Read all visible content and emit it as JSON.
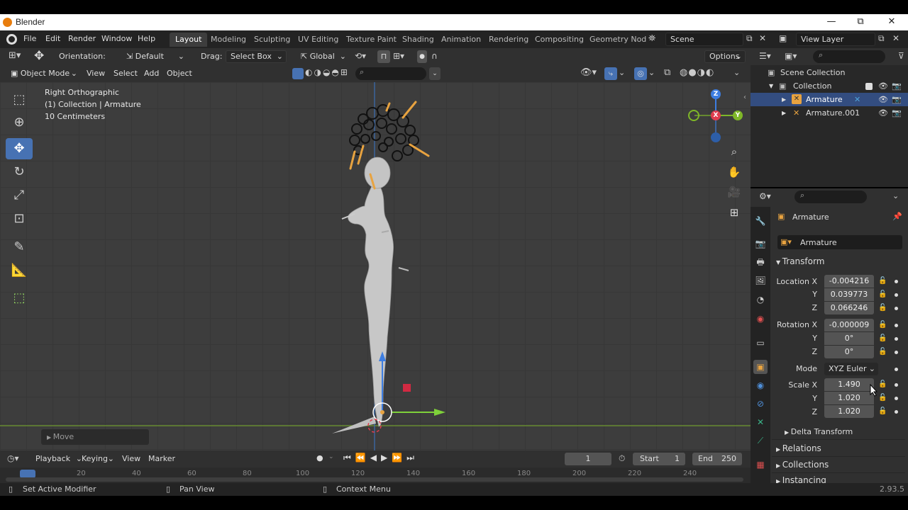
{
  "window": {
    "title": "Blender",
    "minimize": "—",
    "maximize": "⧉",
    "close": "✕"
  },
  "menubar": {
    "menus": [
      "File",
      "Edit",
      "Render",
      "Window",
      "Help"
    ],
    "workspaces": [
      "Layout",
      "Modeling",
      "Sculpting",
      "UV Editing",
      "Texture Paint",
      "Shading",
      "Animation",
      "Rendering",
      "Compositing",
      "Geometry Nod"
    ],
    "active_workspace": "Layout",
    "scene": "Scene",
    "view_layer": "View Layer"
  },
  "tool_header": {
    "orientation_label": "Orientation:",
    "orientation_value": "Default",
    "drag_label": "Drag:",
    "drag_value": "Select Box",
    "transform_orientation": "Global",
    "options": "Options"
  },
  "viewport_header": {
    "mode": "Object Mode",
    "menus": [
      "View",
      "Select",
      "Add",
      "Object"
    ]
  },
  "viewport": {
    "view_name": "Right Orthographic",
    "collection_info": "(1) Collection | Armature",
    "scale_info": "10 Centimeters",
    "last_operator": "Move",
    "gizmo_axes": {
      "z": "Z",
      "x": "X",
      "y": "Y"
    }
  },
  "timeline": {
    "menus": [
      "Playback",
      "Keying",
      "View",
      "Marker"
    ],
    "current_frame": "1",
    "start_label": "Start",
    "start": "1",
    "end_label": "End",
    "end": "250",
    "ticks": [
      "20",
      "40",
      "60",
      "80",
      "100",
      "120",
      "140",
      "160",
      "180",
      "200",
      "220",
      "240"
    ]
  },
  "statusbar": {
    "left": "Set Active Modifier",
    "middle": "Pan View",
    "right": "Context Menu",
    "version": "2.93.5"
  },
  "outliner": {
    "rows": [
      {
        "label": "Scene Collection",
        "indent": 0
      },
      {
        "label": "Collection",
        "indent": 1
      },
      {
        "label": "Armature",
        "indent": 2,
        "selected": true
      },
      {
        "label": "Armature.001",
        "indent": 2
      }
    ]
  },
  "properties": {
    "object_name": "Armature",
    "datablock_name": "Armature",
    "transform_header": "Transform",
    "location_label": "Location X",
    "location": [
      "-0.004216",
      "0.039773",
      "0.066246"
    ],
    "rotation_label": "Rotation X",
    "rotation": [
      "-0.000009",
      "0°",
      "0°"
    ],
    "mode_label": "Mode",
    "mode_value": "XYZ Euler",
    "scale_label": "Scale X",
    "scale": [
      "1.490",
      "1.020",
      "1.020"
    ],
    "axis_y": "Y",
    "axis_z": "Z",
    "sub_panels": [
      "Delta Transform",
      "Relations",
      "Collections",
      "Instancing"
    ]
  },
  "colors": {
    "accent": "#4772b3",
    "x_axis": "#e03d4f",
    "y_axis": "#7fb728",
    "z_axis": "#3d7de0",
    "bone": "#e8a340"
  }
}
